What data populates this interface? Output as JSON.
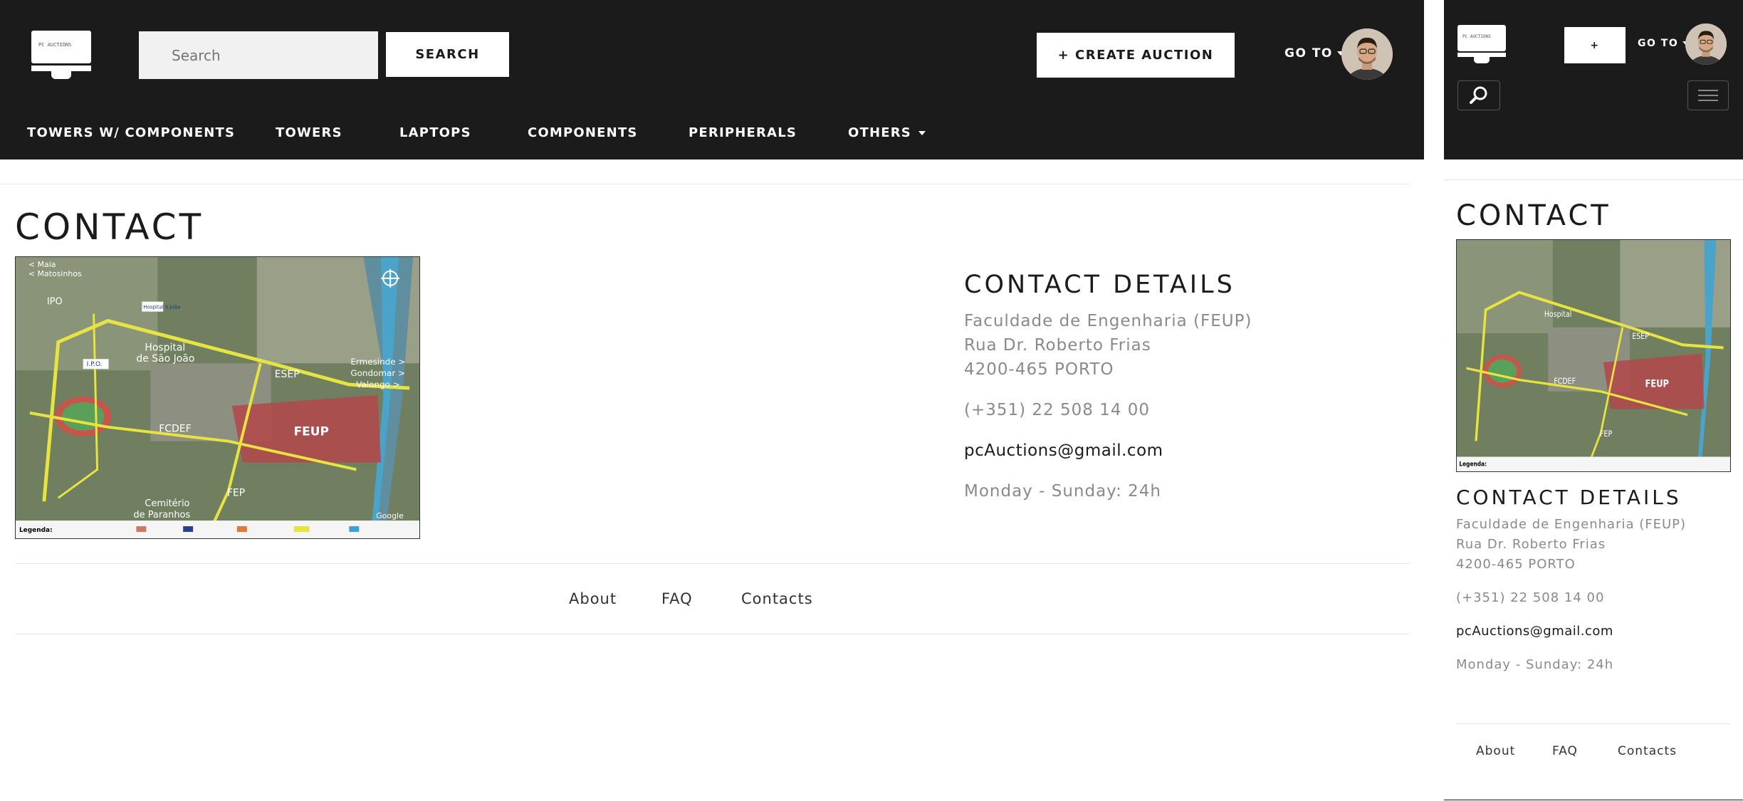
{
  "brand": {
    "logo_text": "PC AUCTIONS"
  },
  "header": {
    "search_placeholder": "Search",
    "search_button": "SEARCH",
    "create_auction": "+ CREATE AUCTION",
    "create_auction_short": "+",
    "goto": "GO TO"
  },
  "categories": [
    {
      "label": "TOWERS W/ COMPONENTS"
    },
    {
      "label": "TOWERS"
    },
    {
      "label": "LAPTOPS"
    },
    {
      "label": "COMPONENTS"
    },
    {
      "label": "PERIPHERALS"
    },
    {
      "label": "OTHERS"
    }
  ],
  "page": {
    "title": "CONTACT"
  },
  "contact": {
    "heading": "CONTACT DETAILS",
    "address_line1": "Faculdade de Engenharia (FEUP)",
    "address_line2": "Rua Dr. Roberto Frias",
    "address_line3": "4200-465 PORTO",
    "phone": "(+351) 22 508 14 00",
    "email": "pcAuctions@gmail.com",
    "hours": "Monday - Sunday: 24h"
  },
  "map_labels": {
    "maia": "< Maia",
    "matosinhos": "< Matosinhos",
    "ipo": "IPO",
    "hospital": "Hospital",
    "sao_joao": "de São João",
    "ipo_box": "I.P.O.",
    "hosp_sjoao": "Hospital S.João",
    "esep": "ESEP",
    "ermesinde": "Ermesinde >",
    "gondomar": "Gondomar >",
    "valongo": "Valongo >",
    "fcdef": "FCDEF",
    "feup": "FEUP",
    "fep": "FEP",
    "cemiterio": "Cemitério",
    "paranhos": "de Paranhos",
    "legenda": "Legenda:",
    "google": "Google"
  },
  "footer": {
    "about": "About",
    "faq": "FAQ",
    "contacts": "Contacts"
  },
  "colors": {
    "nav": "#1b1b1b",
    "muted_text": "#8a8a8a",
    "feup_area": "#b4474a"
  },
  "icons": {
    "search": "search-icon",
    "menu": "hamburger-menu-icon",
    "caret": "caret-down-icon",
    "logo": "monitor-logo"
  }
}
